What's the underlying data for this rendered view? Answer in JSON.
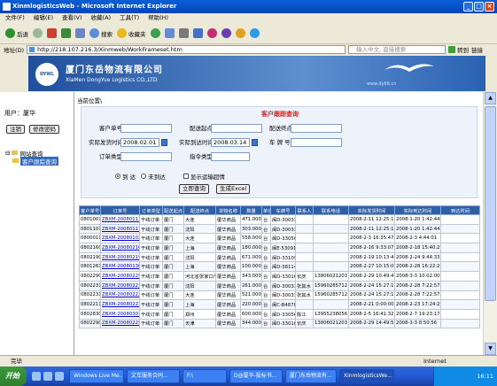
{
  "window": {
    "title": "XinmlogisticsWeb - Microsoft Internet Explorer",
    "buttons": [
      "_",
      "□",
      "×"
    ]
  },
  "menu": [
    "文件(F)",
    "编辑(E)",
    "查看(V)",
    "收藏(A)",
    "工具(T)",
    "帮助(H)"
  ],
  "toolbar": {
    "back": "后退",
    "search": "搜索",
    "favorites": "收藏夹"
  },
  "address": {
    "label": "地址(D)",
    "url": "http://218.107.216.3/Xinmweb/WorkFrameset.htm",
    "search_placeholder": "输入中文, 直接搜索",
    "go": "转到",
    "links": "链接"
  },
  "banner": {
    "logo_text": "DYWL",
    "cn_name": "厦门东岳物流有限公司",
    "en_name": "XiaMen DongYue Logistics CO.,LTD",
    "url_text": "www.dy66.cn"
  },
  "sidebar": {
    "user_label": "用户：",
    "user_name": "厦华",
    "logout": "注销",
    "change_password": "修改密码",
    "tree": [
      {
        "label": "网站查询"
      },
      {
        "label": "客户跟踪查询"
      }
    ]
  },
  "main": {
    "position_label": "当前位置\\",
    "form": {
      "title": "客户跟踪查询",
      "labels": {
        "customer_no": "客户单号：",
        "origin": "配送起点：",
        "destination": "配送终点：",
        "actual_send_time": "实际发货时间：",
        "actual_arrive_time": "实际到达时间：",
        "plate_no": "车 牌 号：",
        "order_type": "订单类型：",
        "instruction_type": "指令类型："
      },
      "values": {
        "actual_send_time": "2008.02.01",
        "actual_arrive_time": "2008.03.14"
      },
      "radios": [
        {
          "label": "到 达",
          "checked": true
        },
        {
          "label": "未到达",
          "checked": false
        }
      ],
      "checkbox": "显示运输超情",
      "buttons": {
        "query": "立即查询",
        "export": "生成Excel"
      }
    },
    "table": {
      "headers": [
        "客户单号",
        "订单号",
        "订单类型",
        "配送起点",
        "配送终点",
        "货物名称",
        "数量",
        "单位",
        "车牌号",
        "联系人",
        "联系电话",
        "实际发货时间",
        "实际到达时间",
        "到达时间"
      ],
      "rows": [
        [
          "08010013",
          "ZBXM-200801130004",
          "干线订单",
          "厦门",
          "大连",
          "厦华商品",
          "471.0000",
          "台",
          "闽D-30033",
          "",
          "",
          "2008-2-11 12:25:15",
          "2008-1-20 1:42:44",
          ""
        ],
        [
          "08011013",
          "ZBXM-200801130006",
          "干线订单",
          "厦门",
          "沈阳",
          "厦华商品",
          "303.0000",
          "台",
          "闽D-30033",
          "",
          "",
          "2008-2-11 12:25:15",
          "2008-1-20 1:42:44",
          ""
        ],
        [
          "08000112",
          "ZBXM-200801020400",
          "干线订单",
          "厦门",
          "大连",
          "厦华商品",
          "558.0000",
          "台",
          "闽D-33056",
          "",
          "",
          "2008-2-3 16:35:47",
          "2008-2-3 4:44:01",
          ""
        ],
        [
          "08021607",
          "ZBXM-200802160006",
          "干线订单",
          "厦门",
          "上海",
          "厦华商品",
          "180.0000",
          "台",
          "闽E-53091",
          "",
          "",
          "2008-2-16 9:33:07",
          "2008-2-18 15:40:21",
          ""
        ],
        [
          "08021903",
          "ZBXM-200802190005",
          "干线订单",
          "厦门",
          "沈阳",
          "厦华商品",
          "671.0000",
          "台",
          "闽D-33109",
          "",
          "",
          "2008-2-19 10:13:40",
          "2008-2-24 9:44:33",
          ""
        ],
        [
          "08012613",
          "ZBXM-200801303000",
          "干线订单",
          "厦门",
          "上海",
          "厦华商品",
          "100.0000",
          "台",
          "闽D-38114",
          "",
          "",
          "2008-2-27 10:15:06",
          "2008-2-28 16:22:25",
          ""
        ],
        [
          "08022902",
          "ZBXM-200802293001",
          "干线订单",
          "厦门",
          "河北省张家口市",
          "厦华商品",
          "343.0000",
          "台",
          "闽D-33016",
          "长庆",
          "13806021203",
          "2008-2-29 10:49:49",
          "2008-3-3 10:02:00",
          ""
        ],
        [
          "08022314",
          "ZBXM-200802230002",
          "干线订单",
          "厦门",
          "沈阳",
          "厦华商品",
          "261.0000",
          "台",
          "闽D-30033",
          "张其水",
          "15960285712",
          "2008-2-24 15:27:17",
          "2008-2-28 7:22:57",
          ""
        ],
        [
          "08022313",
          "ZBXM-200802230003",
          "干线订单",
          "厦门",
          "大连",
          "厦华商品",
          "521.0000",
          "台",
          "闽D-30033",
          "张其水",
          "15960285712",
          "2008-2-24 15:27:17",
          "2008-2-28 7:22:57",
          ""
        ],
        [
          "08022110",
          "ZBXM-200802210004",
          "干线订单",
          "厦门",
          "上海",
          "厦华商品",
          "220.0000",
          "台",
          "闽C-B4878",
          "",
          "",
          "2008-2-21 0:00:00",
          "2008-2-23 17:24:20",
          ""
        ],
        [
          "08028301",
          "ZBXM-200803010005",
          "干线订单",
          "厦门",
          "郑州",
          "厦华商品",
          "600.0000",
          "台",
          "闽D-33056",
          "陈江",
          "13955238056",
          "2008-2-5 16:41:32",
          "2008-2-7 19:23:17",
          ""
        ],
        [
          "08022901",
          "ZBXM-200802290001",
          "干线订单",
          "厦门",
          "天津",
          "厦华商品",
          "344.0000",
          "台",
          "闽D-33016",
          "长庆",
          "13806021203",
          "2008-2-29 14:49:59",
          "2008-3-3 8:50:56",
          ""
        ]
      ]
    }
  },
  "status": {
    "left": "完毕",
    "zone": "Internet"
  },
  "taskbar": {
    "start": "开始",
    "tasks": [
      "Windows Live Me...",
      "文车服务合同...",
      "F:\\",
      "D@厦华-投标书...",
      "厦门东岳物流有...",
      "XinmlogisticsWe..."
    ],
    "clock": "16:11"
  }
}
